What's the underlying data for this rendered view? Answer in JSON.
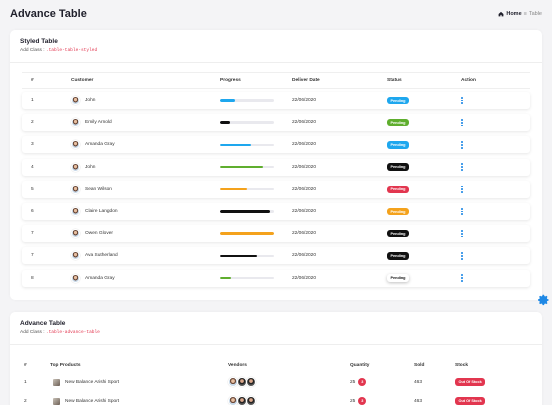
{
  "page": {
    "title": "Advance Table",
    "breadcrumb": {
      "home": "Home",
      "current": "Table"
    }
  },
  "colors": {
    "accent": "#1e88e5",
    "blue": "#1ea7ee",
    "black": "#111111",
    "green": "#5fae2e",
    "orange": "#f4a21c",
    "red": "#e2364f"
  },
  "styled_table": {
    "title": "Styled Table",
    "subtitle_prefix": "Add Class",
    "subtitle_class": ".table-table-styled",
    "columns": [
      "#",
      "Customer",
      "Progress",
      "Deliver Date",
      "Status",
      "Action"
    ],
    "rows": [
      {
        "num": "1",
        "customer": "John",
        "progress": 0.28,
        "progress_color": "#1ea7ee",
        "date": "22/06/2020",
        "status": "Pending",
        "status_color": "#1ea7ee",
        "status_text_color": "#ffffff"
      },
      {
        "num": "2",
        "customer": "Emily Arnold",
        "progress": 0.18,
        "progress_color": "#111111",
        "date": "22/06/2020",
        "status": "Pending",
        "status_color": "#5fae2e",
        "status_text_color": "#ffffff"
      },
      {
        "num": "3",
        "customer": "Amanda Gray",
        "progress": 0.58,
        "progress_color": "#1ea7ee",
        "date": "22/06/2020",
        "status": "Pending",
        "status_color": "#1ea7ee",
        "status_text_color": "#ffffff"
      },
      {
        "num": "4",
        "customer": "John",
        "progress": 0.8,
        "progress_color": "#5fae2e",
        "date": "22/06/2020",
        "status": "Pending",
        "status_color": "#111111",
        "status_text_color": "#ffffff"
      },
      {
        "num": "5",
        "customer": "Sean Wilson",
        "progress": 0.5,
        "progress_color": "#f4a21c",
        "date": "22/06/2020",
        "status": "Pending",
        "status_color": "#e2364f",
        "status_text_color": "#ffffff"
      },
      {
        "num": "6",
        "customer": "Claire Langdon",
        "progress": 0.92,
        "progress_color": "#111111",
        "date": "22/06/2020",
        "status": "Pending",
        "status_color": "#f4a21c",
        "status_text_color": "#ffffff"
      },
      {
        "num": "7",
        "customer": "Owen Glover",
        "progress": 1.0,
        "progress_color": "#f4a21c",
        "date": "22/06/2020",
        "status": "Pending",
        "status_color": "#111111",
        "status_text_color": "#ffffff"
      },
      {
        "num": "7",
        "customer": "Ava Sutherland",
        "progress": 0.68,
        "progress_color": "#111111",
        "date": "22/06/2020",
        "status": "Pending",
        "status_color": "#111111",
        "status_text_color": "#ffffff"
      },
      {
        "num": "8",
        "customer": "Amanda Gray",
        "progress": 0.2,
        "progress_color": "#5fae2e",
        "date": "22/06/2020",
        "status": "Pending",
        "status_color": "#ffffff",
        "status_text_color": "#111111"
      }
    ]
  },
  "advance_table": {
    "title": "Advance Table",
    "subtitle_prefix": "Add Class",
    "subtitle_class": ".table-advance-table",
    "columns": [
      "#",
      "Top Products",
      "Vendors",
      "Quantity",
      "Sold",
      "Stock"
    ],
    "rows": [
      {
        "num": "1",
        "product": "New Balance Arishi Sport",
        "quantity": "25",
        "quantity_badge": "3",
        "sold": "463",
        "stock": "Out Of Stock"
      },
      {
        "num": "2",
        "product": "New Balance Arishi Sport",
        "quantity": "25",
        "quantity_badge": "3",
        "sold": "463",
        "stock": "Out Of Stock"
      }
    ]
  }
}
